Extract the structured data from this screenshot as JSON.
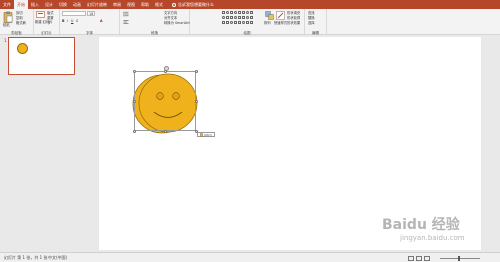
{
  "tabs": [
    "文件",
    "开始",
    "插入",
    "设计",
    "切换",
    "动画",
    "幻灯片放映",
    "审阅",
    "视图",
    "帮助",
    "格式"
  ],
  "active_tab_index": 1,
  "tell_me": "告诉我您想要做什么",
  "ribbon": {
    "clipboard": {
      "label": "剪贴板",
      "cut": "剪切",
      "copy": "复制",
      "format_painter": "格式刷",
      "paste": "粘贴"
    },
    "slides": {
      "label": "幻灯片",
      "new_slide": "新建\n幻灯片",
      "layout": "版式",
      "reset": "重置",
      "section": "节"
    },
    "font": {
      "label": "字体",
      "font_size": "18"
    },
    "paragraph": {
      "label": "段落",
      "text_direction": "文字方向",
      "align_text": "对齐文本",
      "smartart": "转换为 SmartArt"
    },
    "drawing": {
      "label": "绘图",
      "arrange": "排列",
      "quick_styles": "快速样式",
      "shape_fill": "形状填充",
      "shape_outline": "形状轮廓",
      "shape_effects": "形状效果"
    },
    "editing": {
      "label": "编辑",
      "find": "查找",
      "replace": "替换",
      "select": "选择"
    }
  },
  "thumbnail_number": "1",
  "paste_options": "(Ctrl)",
  "status": {
    "slide_info": "幻灯片 第 1 张，共 1 张",
    "language": "中文(中国)"
  },
  "watermark": {
    "brand": "Baidu 经验",
    "url": "jingyan.baidu.com"
  },
  "colors": {
    "accent": "#b7472a",
    "smiley_fill": "#f0b21c",
    "smiley_stroke": "#9a6f0a"
  }
}
